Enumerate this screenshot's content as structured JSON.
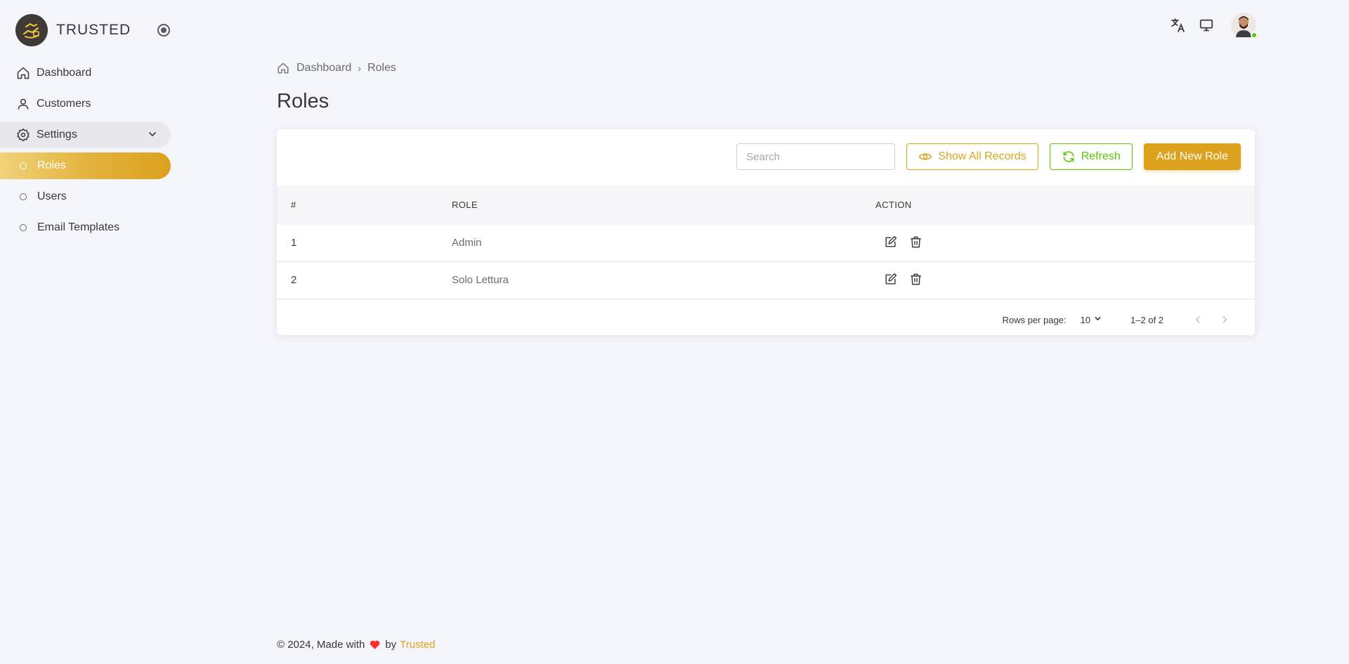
{
  "brand": {
    "name": "TRUSTED"
  },
  "sidebar": {
    "items": [
      {
        "label": "Dashboard",
        "icon": "home-icon"
      },
      {
        "label": "Customers",
        "icon": "user-icon"
      },
      {
        "label": "Settings",
        "icon": "settings-gear-icon",
        "expanded": true
      },
      {
        "label": "Roles",
        "icon": "circle-dot-icon",
        "active": true
      },
      {
        "label": "Users",
        "icon": "circle-dot-icon"
      },
      {
        "label": "Email Templates",
        "icon": "circle-dot-icon"
      }
    ]
  },
  "breadcrumb": {
    "home": "Dashboard",
    "current": "Roles",
    "separator": "›"
  },
  "page": {
    "title": "Roles"
  },
  "toolbar": {
    "search_placeholder": "Search",
    "search_value": "",
    "show_all_label": "Show All Records",
    "refresh_label": "Refresh",
    "add_label": "Add New Role"
  },
  "table": {
    "columns": [
      "#",
      "ROLE",
      "ACTION"
    ],
    "rows": [
      {
        "num": "1",
        "role": "Admin"
      },
      {
        "num": "2",
        "role": "Solo Lettura"
      }
    ]
  },
  "pagination": {
    "rows_per_page_label": "Rows per page:",
    "rows_per_page": "10",
    "range": "1–2 of 2"
  },
  "footer": {
    "prefix": "© 2024, Made with",
    "by": "by",
    "link": "Trusted"
  },
  "colors": {
    "accent": "#dca11d",
    "success": "#56ca00",
    "background": "#f4f5fa",
    "text": "#3a3541"
  }
}
